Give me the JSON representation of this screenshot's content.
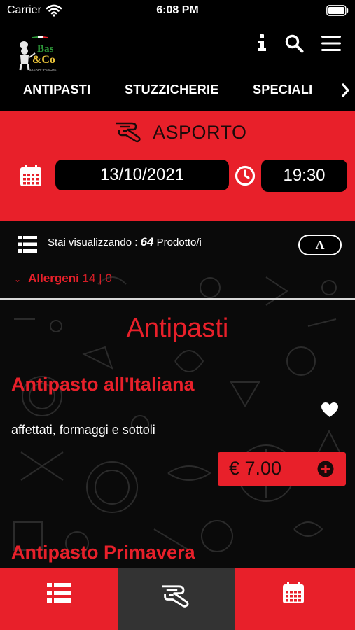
{
  "status_bar": {
    "carrier": "Carrier",
    "time": "6:08 PM"
  },
  "header": {
    "logo_text_top": "Bas",
    "logo_text_bottom": "&Co",
    "logo_tagline": "PIZZERIA · PESCHE"
  },
  "tabs": [
    {
      "label": "ANTIPASTI"
    },
    {
      "label": "STUZZICHERIE"
    },
    {
      "label": "SPECIALI"
    }
  ],
  "order": {
    "mode_label": "ASPORTO",
    "date": "13/10/2021",
    "time": "19:30"
  },
  "listing": {
    "count_prefix": "Stai visualizzando :",
    "count_value": "64",
    "count_suffix": "Prodotto/i",
    "text_size_label": "A",
    "allergens_label": "Allergeni",
    "allergens_counts": "14 | 0",
    "section_title": "Antipasti"
  },
  "products": [
    {
      "name": "Antipasto all'Italiana",
      "description": "affettati, formaggi e sottoli",
      "price": "€ 7.00"
    },
    {
      "name": "Antipasto Primavera"
    }
  ],
  "colors": {
    "accent": "#e8202a",
    "background": "#000000",
    "nav_active": "#333333"
  },
  "icons": [
    "wifi-icon",
    "battery-icon",
    "info-icon",
    "search-icon",
    "menu-icon",
    "takeaway-icon",
    "calendar-icon",
    "clock-icon",
    "list-view-icon",
    "heart-icon",
    "add-icon"
  ]
}
